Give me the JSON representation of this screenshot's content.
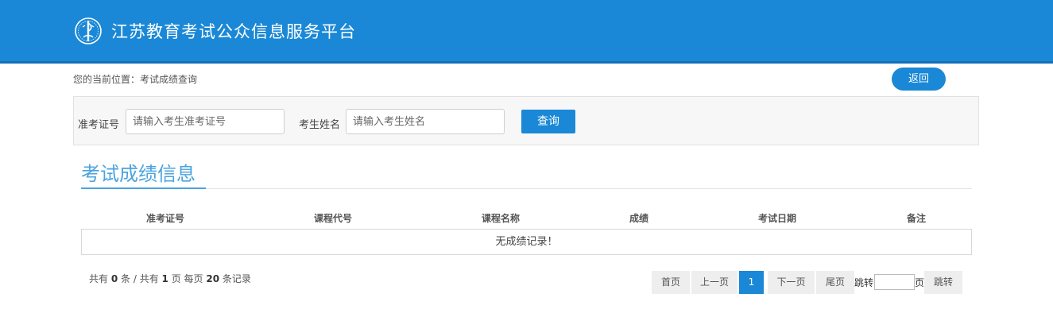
{
  "header": {
    "site_title": "江苏教育考试公众信息服务平台"
  },
  "breadcrumb": "您的当前位置：考试成绩查询",
  "back_label": "返回",
  "search": {
    "exam_no_label": "准考证号",
    "exam_no_placeholder": "请输入考生准考证号",
    "exam_no_value": "",
    "name_label": "考生姓名",
    "name_placeholder": "请输入考生姓名",
    "name_value": "",
    "query_label": "查询"
  },
  "section_title": "考试成绩信息",
  "table": {
    "columns": [
      "准考证号",
      "课程代号",
      "课程名称",
      "成绩",
      "考试日期",
      "备注"
    ],
    "empty_message": "无成绩记录！"
  },
  "summary": {
    "prefix": "共有",
    "total_records": "0",
    "mid1": "条 / 共有",
    "total_pages": "1",
    "mid2": "页 每页",
    "per_page": "20",
    "suffix": "条记录"
  },
  "pagination": {
    "first": "首页",
    "prev": "上一页",
    "current": "1",
    "next": "下一页",
    "last": "尾页",
    "jump_prefix": "跳转",
    "jump_value": "",
    "jump_suffix": "页",
    "jump_button": "跳转"
  },
  "colors": {
    "primary": "#1a88d6",
    "title_blue": "#4aa3df",
    "panel_bg": "#f7f7f7"
  }
}
